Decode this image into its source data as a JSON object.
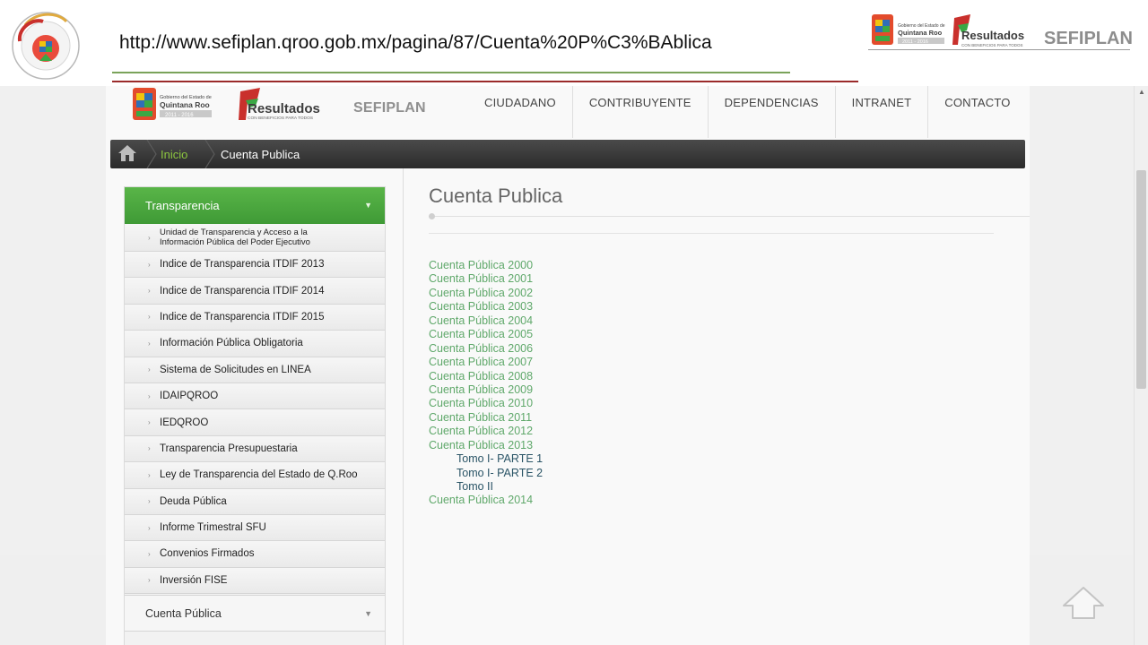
{
  "slide": {
    "url": "http://www.sefiplan.qroo.gob.mx/pagina/87/Cuenta%20P%C3%BAblica",
    "header_logo_text": "SEFIPLAN",
    "seal_text": "AUDITORIA SUPERIOR DEL ESTADO",
    "seal_text_inner": "QUINTANA ROO"
  },
  "header_logos": {
    "gov_text_line1": "Gobierno del Estado de",
    "gov_text_line2": "Quintana Roo",
    "gov_text_line3": "2011 - 2016",
    "resultados": "Resultados",
    "resultados_sub": "CON BENEFICIOS PARA TODOS"
  },
  "nav": {
    "logo_sefiplan": "SEFIPLAN",
    "gov_line1": "Gobierno del Estado de",
    "gov_line2": "Quintana Roo",
    "gov_line3": "2011 - 2016",
    "resultados": "Resultados",
    "resultados_sub": "CON BENEFICIOS PARA TODOS",
    "items": [
      {
        "label": "CIUDADANO"
      },
      {
        "label": "CONTRIBUYENTE"
      },
      {
        "label": "DEPENDENCIAS"
      },
      {
        "label": "INTRANET"
      },
      {
        "label": "CONTACTO"
      }
    ]
  },
  "breadcrumb": {
    "home": "Inicio",
    "current": "Cuenta Publica"
  },
  "sidebar": {
    "title": "Transparencia",
    "items": [
      {
        "label": "Unidad de Transparencia y Acceso  a la Información Pública del Poder Ejecutivo"
      },
      {
        "label": "Indice de Transparencia ITDIF 2013"
      },
      {
        "label": "Indice de Transparencia ITDIF 2014"
      },
      {
        "label": "Indice de Transparencia ITDIF 2015"
      },
      {
        "label": "Información Pública Obligatoria"
      },
      {
        "label": "Sistema de Solicitudes en LINEA"
      },
      {
        "label": "IDAIPQROO"
      },
      {
        "label": "IEDQROO"
      },
      {
        "label": "Transparencia Presupuestaria"
      },
      {
        "label": "Ley de Transparencia del Estado de Q.Roo"
      },
      {
        "label": "Deuda Pública"
      },
      {
        "label": "Informe Trimestral SFU"
      },
      {
        "label": "Convenios Firmados"
      },
      {
        "label": "Inversión FISE"
      }
    ],
    "footer": "Cuenta Pública"
  },
  "content": {
    "title": "Cuenta Publica",
    "links": [
      {
        "label": "Cuenta Pública 2000",
        "sub": false
      },
      {
        "label": "Cuenta Pública 2001",
        "sub": false
      },
      {
        "label": "Cuenta Pública 2002",
        "sub": false
      },
      {
        "label": "Cuenta Pública 2003",
        "sub": false
      },
      {
        "label": "Cuenta Pública 2004",
        "sub": false
      },
      {
        "label": "Cuenta Pública 2005",
        "sub": false
      },
      {
        "label": "Cuenta Pública 2006",
        "sub": false
      },
      {
        "label": "Cuenta Pública 2007",
        "sub": false
      },
      {
        "label": "Cuenta Pública 2008",
        "sub": false
      },
      {
        "label": "Cuenta Pública 2009",
        "sub": false
      },
      {
        "label": "Cuenta Pública 2010",
        "sub": false
      },
      {
        "label": "Cuenta Pública 2011",
        "sub": false
      },
      {
        "label": "Cuenta Pública 2012",
        "sub": false
      },
      {
        "label": "Cuenta Pública 2013",
        "sub": false
      },
      {
        "label": "Tomo I- PARTE 1",
        "sub": true
      },
      {
        "label": "Tomo I- PARTE 2",
        "sub": true
      },
      {
        "label": "Tomo II",
        "sub": true
      },
      {
        "label": "Cuenta Pública 2014",
        "sub": false
      }
    ]
  },
  "colors": {
    "accent_green": "#4aa83e",
    "link_green": "#5fa86a",
    "link_dark": "#2a5466",
    "breadcrumb_inicio": "#8cc63f",
    "rule_green": "#7aa35a",
    "rule_red": "#9b2b2b"
  },
  "icons": {
    "home": "home-icon",
    "caret": "chevron-down-icon",
    "bullet": "chevron-right-icon",
    "up": "arrow-up-icon"
  }
}
